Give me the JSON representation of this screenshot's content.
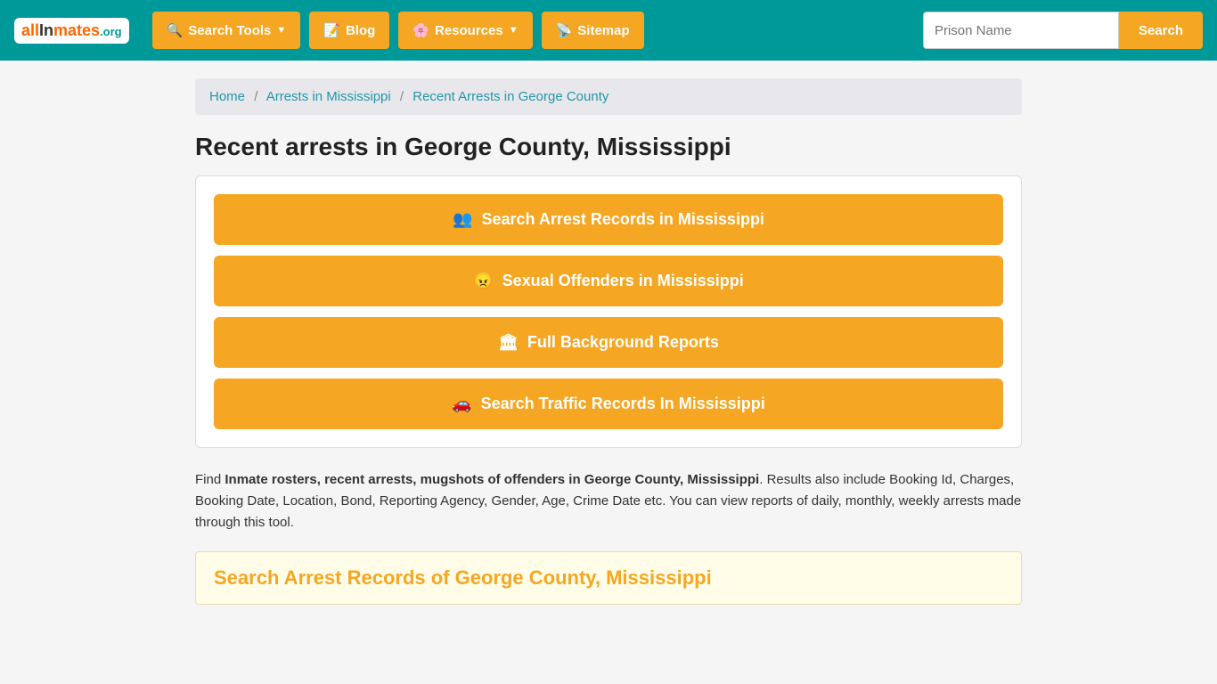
{
  "nav": {
    "logo_text": "allInmates.org",
    "logo_all": "all",
    "logo_in": "In",
    "logo_mates": "mates",
    "logo_org": ".org",
    "search_tools_label": "Search Tools",
    "blog_label": "Blog",
    "resources_label": "Resources",
    "sitemap_label": "Sitemap",
    "search_placeholder": "Prison Name",
    "search_btn_label": "Search"
  },
  "breadcrumb": {
    "home": "Home",
    "arrests_ms": "Arrests in Mississippi",
    "current": "Recent Arrests in George County"
  },
  "main": {
    "page_title": "Recent arrests in George County, Mississippi",
    "btn1": "Search Arrest Records in Mississippi",
    "btn2": "Sexual Offenders in Mississippi",
    "btn3": "Full Background Reports",
    "btn4": "Search Traffic Records In Mississippi",
    "description_intro": "Find ",
    "description_bold": "Inmate rosters, recent arrests, mugshots of offenders in George County, Mississippi",
    "description_rest": ". Results also include Booking Id, Charges, Booking Date, Location, Bond, Reporting Agency, Gender, Age, Crime Date etc. You can view reports of daily, monthly, weekly arrests made through this tool.",
    "bottom_heading": "Search Arrest Records of George County, Mississippi"
  }
}
